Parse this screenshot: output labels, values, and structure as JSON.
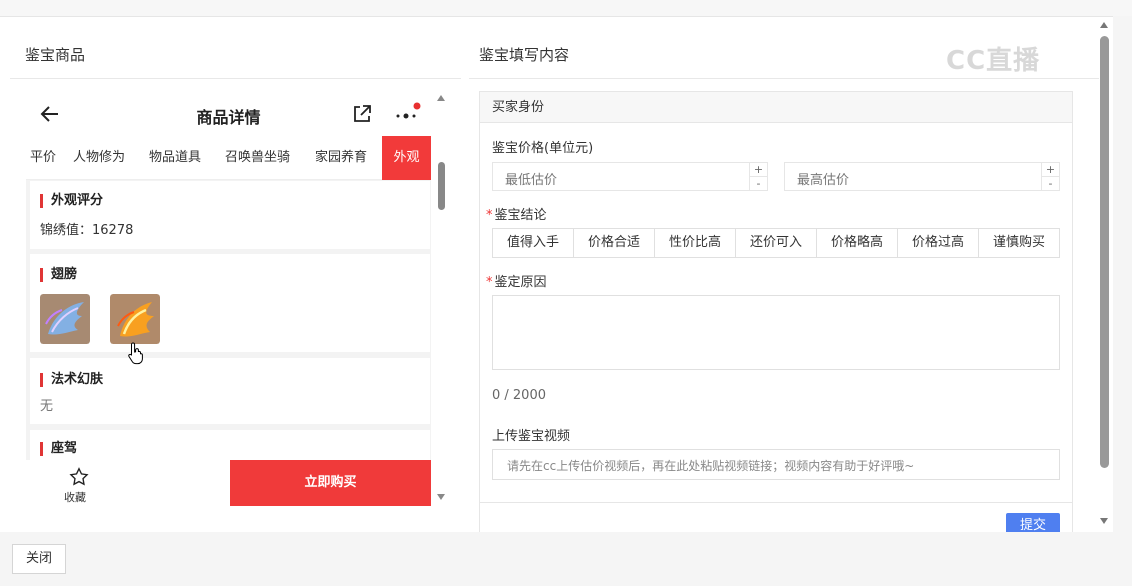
{
  "left_panel": {
    "title": "鉴宝商品",
    "phone": {
      "header_title": "商品详情",
      "tabs": [
        "平价",
        "人物修为",
        "物品道具",
        "召唤兽坐骑",
        "家园养育",
        "外观"
      ],
      "active_tab": "外观",
      "sections": {
        "appearance_score": {
          "title": "外观评分",
          "value": "锦绣值：16278"
        },
        "wings": {
          "title": "翅膀"
        },
        "spell_skin": {
          "title": "法术幻肤",
          "value": "无"
        },
        "mount": {
          "title": "座驾"
        }
      },
      "bottom": {
        "favorite_label": "收藏",
        "buy_label": "立即购买"
      }
    }
  },
  "right_panel": {
    "title": "鉴宝填写内容",
    "form": {
      "header": "买家身份",
      "price_label": "鉴宝价格(单位元)",
      "min_price_placeholder": "最低估价",
      "max_price_placeholder": "最高估价",
      "stepper_plus": "+",
      "stepper_minus": "-",
      "conclusion_label": "鉴宝结论",
      "conclusions": [
        "值得入手",
        "价格合适",
        "性价比高",
        "还价可入",
        "价格略高",
        "价格过高",
        "谨慎购买"
      ],
      "reason_label": "鉴定原因",
      "reason_counter": "0 / 2000",
      "video_label": "上传鉴宝视频",
      "video_placeholder": "请先在cc上传估价视频后，再在此处粘贴视频链接；视频内容有助于好评哦~",
      "submit_label": "提交"
    }
  },
  "watermark": "CC直播",
  "footer": {
    "close_label": "关闭"
  },
  "colors": {
    "accent_red": "#f03a3a",
    "primary_blue": "#4f7ff0"
  }
}
